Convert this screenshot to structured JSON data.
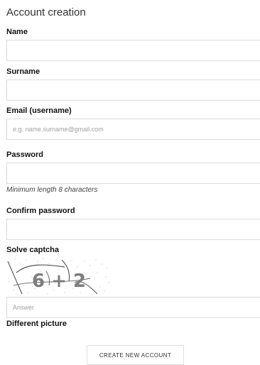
{
  "form": {
    "title": "Account creation",
    "fields": {
      "name": {
        "label": "Name",
        "value": "",
        "placeholder": ""
      },
      "surname": {
        "label": "Surname",
        "value": "",
        "placeholder": ""
      },
      "email": {
        "label": "Email (username)",
        "value": "",
        "placeholder": "e.g. name.surname@gmail.com"
      },
      "password": {
        "label": "Password",
        "value": "",
        "placeholder": "",
        "hint": "Minimum length 8 characters"
      },
      "confirm_password": {
        "label": "Confirm password",
        "value": "",
        "placeholder": ""
      }
    },
    "captcha": {
      "label": "Solve captcha",
      "expression": "6 + 2",
      "answer_placeholder": "Answer",
      "refresh_label": "Different picture"
    },
    "submit_label": "CREATE NEW ACCOUNT"
  }
}
